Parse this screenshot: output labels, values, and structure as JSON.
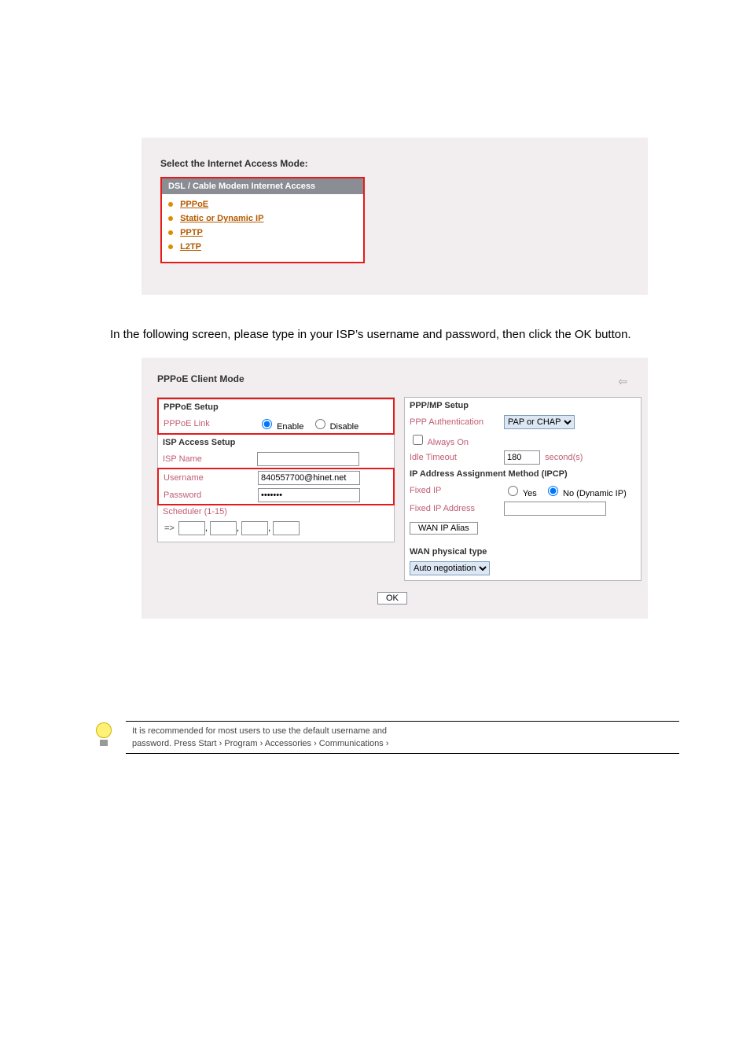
{
  "shot1": {
    "heading": "Select the Internet Access Mode:",
    "bar": "DSL / Cable Modem Internet Access",
    "items": [
      "PPPoE",
      "Static or Dynamic IP",
      "PPTP",
      "L2TP"
    ]
  },
  "body": {
    "p1": "In the following screen, please type in your ISP’s username and password, then click the OK button."
  },
  "shot2": {
    "title": "PPPoE Client Mode",
    "left": {
      "setup_hdr": "PPPoE Setup",
      "link_label": "PPPoE Link",
      "enable": "Enable",
      "disable": "Disable",
      "isp_hdr": "ISP Access Setup",
      "isp_name_label": "ISP Name",
      "isp_name_value": "",
      "username_label": "Username",
      "username_value": "840557700@hinet.net",
      "password_label": "Password",
      "password_value": "•••••••",
      "scheduler_label": "Scheduler (1-15)",
      "arrow": "=>"
    },
    "right": {
      "ppp_hdr": "PPP/MP Setup",
      "auth_label": "PPP Authentication",
      "auth_value": "PAP or CHAP",
      "always_on": "Always On",
      "idle_label": "Idle Timeout",
      "idle_value": "180",
      "idle_unit": "second(s)",
      "ipcp_hdr": "IP Address Assignment Method (IPCP)",
      "fixed_ip_label": "Fixed IP",
      "yes": "Yes",
      "no": "No (Dynamic IP)",
      "fixed_addr_label": "Fixed IP Address",
      "wan_alias_btn": "WAN IP Alias",
      "wan_phys_hdr": "WAN physical type",
      "wan_phys_value": "Auto negotiation"
    },
    "ok": "OK"
  },
  "tip": {
    "line1": "It is recommended for most users to use the default username and",
    "line2": "password. Press Start › Program › Accessories › Communications ›"
  }
}
